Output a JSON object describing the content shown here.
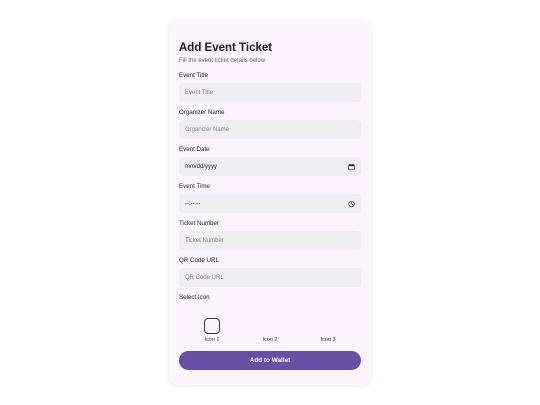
{
  "form": {
    "title": "Add Event Ticket",
    "subtitle": "Fill the event ticket details below",
    "fields": [
      {
        "label": "Event Title",
        "placeholder": "Event Title"
      },
      {
        "label": "Organizer Name",
        "placeholder": "Organizer Name"
      },
      {
        "label": "Event Date",
        "value": "mm/dd/yyyy"
      },
      {
        "label": "Event Time",
        "value": "--:-- --"
      },
      {
        "label": "Ticket Number",
        "placeholder": "Ticket Number"
      },
      {
        "label": "QR Code URL",
        "placeholder": "QR Code URL"
      }
    ],
    "icon_section_label": "Select Icon",
    "icons": [
      {
        "label": "Icon 1",
        "selected": true
      },
      {
        "label": "Icon 2",
        "selected": false
      },
      {
        "label": "Icon 3",
        "selected": false
      }
    ],
    "submit_label": "Add to Wallet"
  },
  "colors": {
    "card_bg": "#fcf5fd",
    "input_bg": "#efeef0",
    "primary": "#6750a4"
  }
}
